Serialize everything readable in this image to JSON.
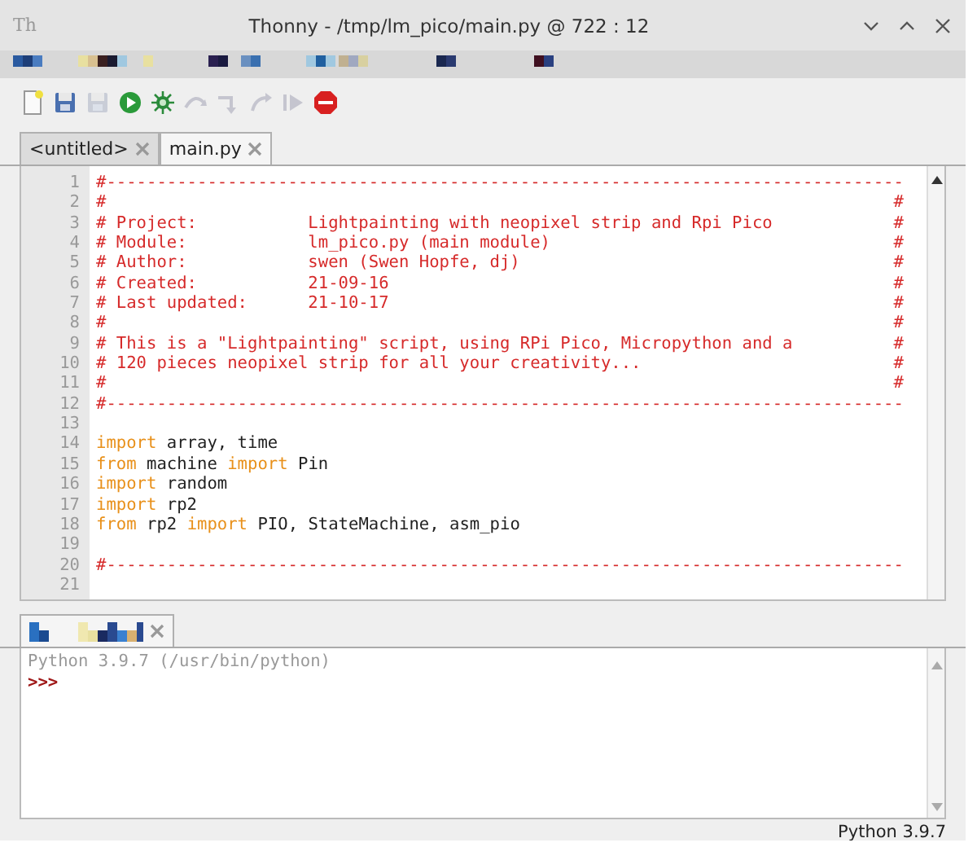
{
  "window": {
    "app_icon": "Th",
    "title": "Thonny - /tmp/lm_pico/main.py @ 722 : 12"
  },
  "toolbar": [
    {
      "kind": "new",
      "disabled": false
    },
    {
      "kind": "save",
      "disabled": false
    },
    {
      "kind": "save",
      "disabled": true
    },
    {
      "kind": "run",
      "disabled": false
    },
    {
      "kind": "debug",
      "disabled": false
    },
    {
      "kind": "step-over",
      "disabled": true
    },
    {
      "kind": "step-into",
      "disabled": true
    },
    {
      "kind": "step-out",
      "disabled": true
    },
    {
      "kind": "resume",
      "disabled": true
    },
    {
      "kind": "stop",
      "disabled": false
    }
  ],
  "tabs": [
    {
      "label": "<untitled>",
      "selected": false
    },
    {
      "label": "main.py",
      "selected": true
    }
  ],
  "editor": {
    "lines": [
      {
        "number": "1",
        "tokens": [
          {
            "kind": "comment",
            "text": "#-------------------------------------------------------------------------------"
          }
        ]
      },
      {
        "number": "2",
        "tokens": [
          {
            "kind": "comment",
            "text": "#                                                                              #"
          }
        ]
      },
      {
        "number": "3",
        "tokens": [
          {
            "kind": "comment",
            "text": "# Project:           Lightpainting with neopixel strip and Rpi Pico            #"
          }
        ]
      },
      {
        "number": "4",
        "tokens": [
          {
            "kind": "comment",
            "text": "# Module:            lm_pico.py (main module)                                  #"
          }
        ]
      },
      {
        "number": "5",
        "tokens": [
          {
            "kind": "comment",
            "text": "# Author:            swen (Swen Hopfe, dj)                                     #"
          }
        ]
      },
      {
        "number": "6",
        "tokens": [
          {
            "kind": "comment",
            "text": "# Created:           21-09-16                                                  #"
          }
        ]
      },
      {
        "number": "7",
        "tokens": [
          {
            "kind": "comment",
            "text": "# Last updated:      21-10-17                                                  #"
          }
        ]
      },
      {
        "number": "8",
        "tokens": [
          {
            "kind": "comment",
            "text": "#                                                                              #"
          }
        ]
      },
      {
        "number": "9",
        "tokens": [
          {
            "kind": "comment",
            "text": "# This is a \"Lightpainting\" script, using RPi Pico, Micropython and a          #"
          }
        ]
      },
      {
        "number": "10",
        "tokens": [
          {
            "kind": "comment",
            "text": "# 120 pieces neopixel strip for all your creativity...                         #"
          }
        ]
      },
      {
        "number": "11",
        "tokens": [
          {
            "kind": "comment",
            "text": "#                                                                              #"
          }
        ]
      },
      {
        "number": "12",
        "tokens": [
          {
            "kind": "comment",
            "text": "#-------------------------------------------------------------------------------"
          }
        ]
      },
      {
        "number": "13"
      },
      {
        "number": "14",
        "tokens": [
          {
            "kind": "keyword",
            "text": "import"
          },
          {
            "kind": "text",
            "text": " array, time"
          }
        ]
      },
      {
        "number": "15",
        "tokens": [
          {
            "kind": "keyword",
            "text": "from"
          },
          {
            "kind": "text",
            "text": " machine "
          },
          {
            "kind": "keyword",
            "text": "import"
          },
          {
            "kind": "text",
            "text": " Pin"
          }
        ]
      },
      {
        "number": "16",
        "tokens": [
          {
            "kind": "keyword",
            "text": "import"
          },
          {
            "kind": "text",
            "text": " random"
          }
        ]
      },
      {
        "number": "17",
        "tokens": [
          {
            "kind": "keyword",
            "text": "import"
          },
          {
            "kind": "text",
            "text": " rp2"
          }
        ]
      },
      {
        "number": "18",
        "tokens": [
          {
            "kind": "keyword",
            "text": "from"
          },
          {
            "kind": "text",
            "text": " rp2 "
          },
          {
            "kind": "keyword",
            "text": "import"
          },
          {
            "kind": "text",
            "text": " PIO, StateMachine, asm_pio"
          }
        ]
      },
      {
        "number": "19"
      },
      {
        "number": "20",
        "tokens": [
          {
            "kind": "comment",
            "text": "#-------------------------------------------------------------------------------"
          }
        ]
      },
      {
        "number": "21"
      }
    ]
  },
  "shell": {
    "lines": [
      {
        "kind": "banner",
        "text": "Python 3.9.7 (/usr/bin/python)"
      },
      {
        "kind": "prompt",
        "text": ">>>"
      }
    ]
  },
  "status_bar": {
    "interpreter": "Python 3.9.7"
  }
}
